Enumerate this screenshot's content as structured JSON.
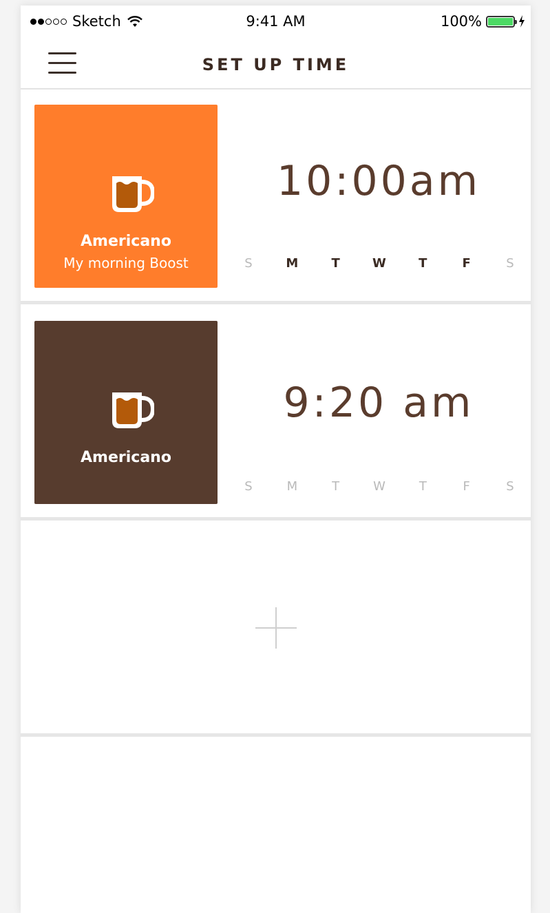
{
  "status_bar": {
    "carrier": "Sketch",
    "time": "9:41 AM",
    "battery": "100%"
  },
  "header": {
    "title": "SET UP TIME",
    "menu_icon": "hamburger-icon"
  },
  "alarms": [
    {
      "drink": "Americano",
      "label": "My morning Boost",
      "time": "10:00am",
      "tile_color": "#FF7D2B",
      "days": [
        "S",
        "M",
        "T",
        "W",
        "T",
        "F",
        "S"
      ],
      "active_days": [
        false,
        true,
        true,
        true,
        true,
        true,
        false
      ]
    },
    {
      "drink": "Americano",
      "time": "9:20 am",
      "tile_color": "#573C2E",
      "days": [
        "S",
        "M",
        "T",
        "W",
        "T",
        "F",
        "S"
      ],
      "active_days": [
        false,
        false,
        false,
        false,
        false,
        false,
        false
      ]
    }
  ],
  "add_button": {
    "icon": "plus-icon"
  },
  "colors": {
    "orange": "#FF7D2B",
    "brown": "#573C2E",
    "coffee": "#B35A0A",
    "time_text": "#5A3C2D"
  }
}
